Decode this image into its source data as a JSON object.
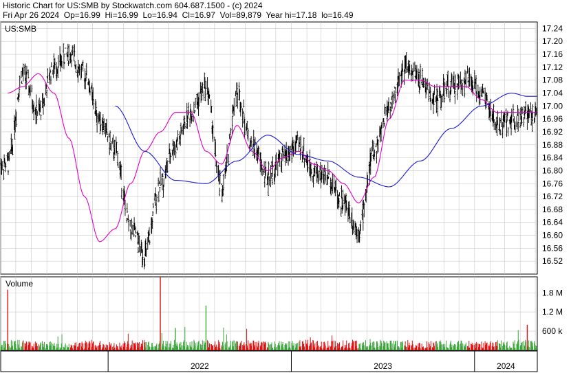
{
  "header": {
    "title": "Historic Chart for US:SMB by Stockwatch.com 604.687.1500 - (c) 2024",
    "date": "Fri Apr 26 2024",
    "open_label": "Op=16.99",
    "high_label": "Hi=16.99",
    "low_label": "Lo=16.94",
    "close_label": "Cl=16.97",
    "volume_label": "Vol=89,879",
    "year_hi_label": "Year hi=17.18",
    "year_lo_label": "lo=16.49"
  },
  "colors": {
    "price_bars": "#000000",
    "ma_fast": "#e000c8",
    "ma_slow": "#1a1ad0",
    "volume_up": "#3aa53a",
    "volume_down": "#e01010",
    "grid": "#c8c8c8",
    "border": "#000000"
  },
  "chart_data": [
    {
      "type": "line",
      "subtype": "ohlc-bars",
      "symbol_label": "US:SMB",
      "ylim": [
        16.48,
        17.26
      ],
      "y_ticks": [
        "17.24",
        "17.20",
        "17.16",
        "17.12",
        "17.08",
        "17.04",
        "17.00",
        "16.96",
        "16.92",
        "16.88",
        "16.84",
        "16.80",
        "16.76",
        "16.72",
        "16.68",
        "16.64",
        "16.60",
        "16.56",
        "16.52"
      ],
      "x_labels": [
        "2022",
        "2023",
        "2024"
      ],
      "series": [
        {
          "kind": "close",
          "x": [
            "2021-06",
            "2021-07",
            "2021-08",
            "2021-09",
            "2021-10",
            "2021-11",
            "2021-12",
            "2022-01",
            "2022-02",
            "2022-03",
            "2022-04",
            "2022-05",
            "2022-06",
            "2022-07",
            "2022-08",
            "2022-09",
            "2022-10",
            "2022-11",
            "2022-12",
            "2023-01",
            "2023-02",
            "2023-03",
            "2023-04",
            "2023-05",
            "2023-06",
            "2023-07",
            "2023-08",
            "2023-09",
            "2023-10",
            "2023-11",
            "2023-12",
            "2024-01",
            "2024-02",
            "2024-03",
            "2024-04"
          ],
          "values": [
            16.82,
            17.1,
            16.98,
            17.12,
            17.16,
            17.1,
            16.96,
            16.86,
            16.62,
            16.54,
            16.76,
            16.88,
            16.98,
            17.06,
            16.74,
            17.04,
            16.88,
            16.78,
            16.84,
            16.88,
            16.8,
            16.78,
            16.7,
            16.62,
            16.86,
            17.0,
            17.12,
            17.08,
            17.02,
            17.06,
            17.08,
            17.04,
            16.94,
            16.96,
            16.97
          ]
        },
        {
          "kind": "moving-average-fast",
          "x": [
            "2021-06",
            "2021-07",
            "2021-08",
            "2021-09",
            "2021-10",
            "2021-11",
            "2021-12",
            "2022-01",
            "2022-02",
            "2022-03",
            "2022-04",
            "2022-05",
            "2022-06",
            "2022-07",
            "2022-08",
            "2022-09",
            "2022-10",
            "2022-11",
            "2022-12",
            "2023-01",
            "2023-02",
            "2023-03",
            "2023-04",
            "2023-05",
            "2023-06",
            "2023-07",
            "2023-08",
            "2023-09",
            "2023-10",
            "2023-11",
            "2023-12",
            "2024-01",
            "2024-02",
            "2024-03",
            "2024-04"
          ],
          "values": [
            17.04,
            17.06,
            17.1,
            17.04,
            16.9,
            16.72,
            16.58,
            16.62,
            16.76,
            16.86,
            16.92,
            16.98,
            16.98,
            16.86,
            16.82,
            16.94,
            16.86,
            16.8,
            16.84,
            16.86,
            16.82,
            16.8,
            16.76,
            16.7,
            16.78,
            16.96,
            17.08,
            17.08,
            17.06,
            17.06,
            17.06,
            17.02,
            16.98,
            16.98,
            16.98
          ]
        },
        {
          "kind": "moving-average-slow",
          "x": [
            "2022-01",
            "2022-03",
            "2022-05",
            "2022-07",
            "2022-09",
            "2022-11",
            "2023-01",
            "2023-03",
            "2023-05",
            "2023-07",
            "2023-09",
            "2023-11",
            "2024-01",
            "2024-03",
            "2024-04"
          ],
          "values": [
            17.0,
            16.86,
            16.77,
            16.76,
            16.83,
            16.91,
            16.85,
            16.83,
            16.78,
            16.75,
            16.83,
            16.93,
            17.0,
            17.04,
            17.03
          ]
        }
      ]
    },
    {
      "type": "bar",
      "title": "Volume",
      "y_ticks": [
        "1.8 M",
        "1.2 M",
        "600 k"
      ],
      "ylim": [
        0,
        2300000
      ],
      "series": [
        {
          "name": "Volume",
          "x": [
            "2021-06",
            "2021-07",
            "2021-08",
            "2021-09",
            "2021-10",
            "2021-11",
            "2021-12",
            "2022-01",
            "2022-02",
            "2022-03",
            "2022-04",
            "2022-05",
            "2022-06",
            "2022-07",
            "2022-08",
            "2022-09",
            "2022-10",
            "2022-11",
            "2022-12",
            "2023-01",
            "2023-02",
            "2023-03",
            "2023-04",
            "2023-05",
            "2023-06",
            "2023-07",
            "2023-08",
            "2023-09",
            "2023-10",
            "2023-11",
            "2023-12",
            "2024-01",
            "2024-02",
            "2024-03",
            "2024-04"
          ],
          "values": [
            1900000,
            450000,
            300000,
            250000,
            200000,
            350000,
            280000,
            220000,
            300000,
            500000,
            2300000,
            700000,
            600000,
            1400000,
            500000,
            400000,
            300000,
            250000,
            300000,
            350000,
            300000,
            280000,
            400000,
            450000,
            500000,
            350000,
            300000,
            250000,
            300000,
            280000,
            300000,
            250000,
            350000,
            250000,
            800000
          ]
        }
      ]
    }
  ]
}
